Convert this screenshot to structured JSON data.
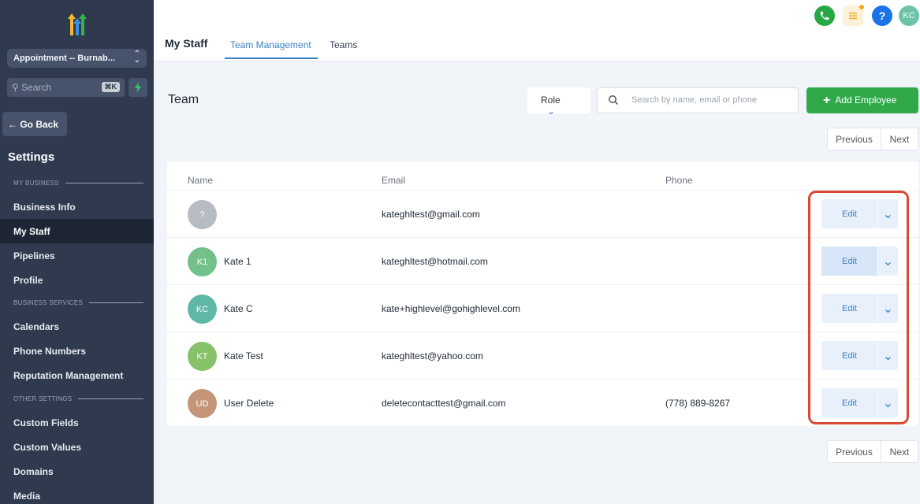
{
  "sidebar": {
    "location": "Appointment -- Burnab...",
    "search_placeholder": "Search",
    "search_shortcut": "⌘K",
    "go_back": "← Go Back",
    "settings_title": "Settings",
    "sections": [
      {
        "label": "MY BUSINESS"
      },
      {
        "label": "BUSINESS SERVICES"
      },
      {
        "label": "OTHER SETTINGS"
      }
    ],
    "items": [
      {
        "label": "Business Info"
      },
      {
        "label": "My Staff"
      },
      {
        "label": "Pipelines"
      },
      {
        "label": "Profile"
      },
      {
        "label": "Calendars"
      },
      {
        "label": "Phone Numbers"
      },
      {
        "label": "Reputation Management"
      },
      {
        "label": "Custom Fields"
      },
      {
        "label": "Custom Values"
      },
      {
        "label": "Domains"
      },
      {
        "label": "Media"
      }
    ]
  },
  "header": {
    "title": "My Staff",
    "tabs": [
      {
        "label": "Team Management",
        "active": true
      },
      {
        "label": "Teams",
        "active": false
      }
    ],
    "user_initials": "KC",
    "help_label": "?"
  },
  "main": {
    "heading": "Team",
    "role_filter": "Role",
    "search_placeholder": "Search by name, email or phone",
    "add_button": "Add Employee",
    "pager": {
      "previous": "Previous",
      "next": "Next"
    },
    "table": {
      "columns": [
        "Name",
        "Email",
        "Phone"
      ],
      "rows": [
        {
          "initials": "?",
          "name": "",
          "email": "kateghltest@gmail.com",
          "phone": "",
          "avatar_color": "#b7bcc3"
        },
        {
          "initials": "K1",
          "name": "Kate 1",
          "email": "kateghltest@hotmail.com",
          "phone": "",
          "avatar_color": "#73c08a"
        },
        {
          "initials": "KC",
          "name": "Kate C",
          "email": "kate+highlevel@gohighlevel.com",
          "phone": "",
          "avatar_color": "#5fb7a8"
        },
        {
          "initials": "KT",
          "name": "Kate Test",
          "email": "kateghltest@yahoo.com",
          "phone": "",
          "avatar_color": "#86c26a"
        },
        {
          "initials": "UD",
          "name": "User Delete",
          "email": "deletecontacttest@gmail.com",
          "phone": "(778) 889-8267",
          "avatar_color": "#c49577"
        }
      ],
      "edit_label": "Edit"
    }
  },
  "colors": {
    "sidebar_bg": "#2f3a4f",
    "accent": "#3b82c4",
    "add_button": "#2fa94a",
    "highlight": "#d94a35"
  }
}
